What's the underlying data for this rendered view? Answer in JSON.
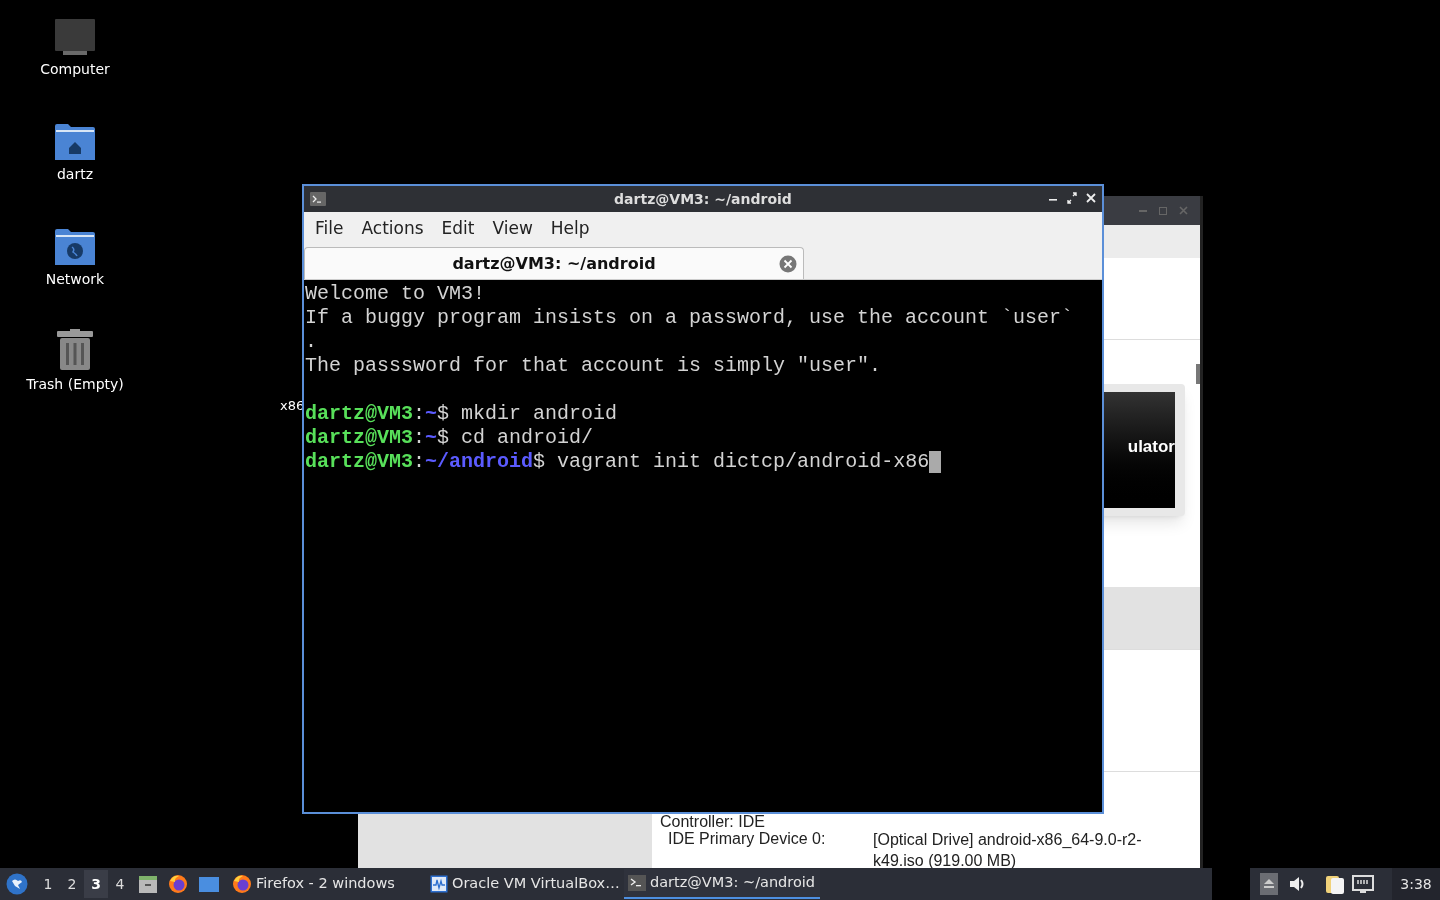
{
  "desktop_icons": [
    {
      "label": "Computer",
      "kind": "computer"
    },
    {
      "label": "dartz",
      "kind": "home"
    },
    {
      "label": "Network",
      "kind": "network"
    },
    {
      "label": "Trash (Empty)",
      "kind": "trash"
    }
  ],
  "desktop_label_cut": "x86",
  "background_window": {
    "preview_text": "ulator",
    "details": [
      {
        "label": "Controller: IDE"
      },
      {
        "label": "IDE Primary Device 0:",
        "value": "[Optical Drive] android-x86_64-9.0-r2-\nk49.iso (919.00 MB)"
      }
    ]
  },
  "terminal": {
    "title": "dartz@VM3: ~/android",
    "menu": [
      "File",
      "Actions",
      "Edit",
      "View",
      "Help"
    ],
    "tabs": [
      {
        "label": "dartz@VM3: ~/android",
        "selected": true
      }
    ],
    "lines": [
      [
        {
          "kind": "text",
          "text": "Welcome to VM3!"
        }
      ],
      [
        {
          "kind": "text",
          "text": "If a buggy program insists on a password, use the account `user`"
        }
      ],
      [
        {
          "kind": "text",
          "text": "."
        }
      ],
      [
        {
          "kind": "text",
          "text": "The passsword for that account is simply \"user\"."
        }
      ],
      [
        {
          "kind": "blank"
        },
        {
          "kind": "user",
          "text": "dartz@VM3"
        },
        {
          "kind": "text",
          "text": ":"
        },
        {
          "kind": "path",
          "text": "~"
        },
        {
          "kind": "text",
          "text": "$ mkdir android"
        }
      ],
      [
        {
          "kind": "user",
          "text": "dartz@VM3"
        },
        {
          "kind": "text",
          "text": ":"
        },
        {
          "kind": "path",
          "text": "~"
        },
        {
          "kind": "text",
          "text": "$ cd android/"
        }
      ],
      [
        {
          "kind": "user",
          "text": "dartz@VM3"
        },
        {
          "kind": "text",
          "text": ":"
        },
        {
          "kind": "path",
          "text": "~/android"
        },
        {
          "kind": "text",
          "text": "$ vagrant init dictcp/android-x86"
        },
        {
          "kind": "cursor"
        }
      ]
    ]
  },
  "taskbar": {
    "workspaces": [
      {
        "label": "1",
        "selected": false
      },
      {
        "label": "2",
        "selected": false
      },
      {
        "label": "3",
        "selected": true
      },
      {
        "label": "4",
        "selected": false
      }
    ],
    "launchers": [
      {
        "kind": "files"
      },
      {
        "kind": "firefox"
      },
      {
        "kind": "desktop"
      }
    ],
    "tasks": [
      {
        "label": "Firefox - 2 windows",
        "kind": "firefox",
        "selected": false
      },
      {
        "label": "Oracle VM VirtualBox…",
        "kind": "virtualbox",
        "selected": false
      },
      {
        "label": "dartz@VM3: ~/android",
        "kind": "terminal",
        "selected": true
      }
    ],
    "clock": "3:38"
  }
}
